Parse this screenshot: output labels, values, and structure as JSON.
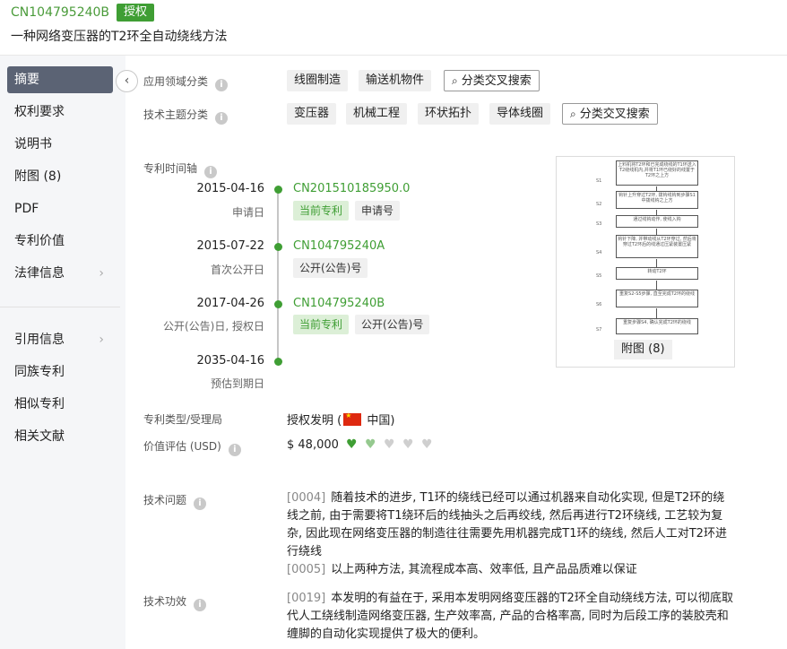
{
  "header": {
    "patent_number": "CN104795240B",
    "status": "授权",
    "title": "一种网络变压器的T2环全自动绕线方法"
  },
  "sidebar": {
    "items": [
      {
        "label": "摘要",
        "active": true
      },
      {
        "label": "权利要求"
      },
      {
        "label": "说明书"
      },
      {
        "label": "附图 (8)"
      },
      {
        "label": "PDF"
      },
      {
        "label": "专利价值"
      },
      {
        "label": "法律信息",
        "has_chevron": true
      }
    ],
    "items2": [
      {
        "label": "引用信息",
        "has_chevron": true
      },
      {
        "label": "同族专利"
      },
      {
        "label": "相似专利"
      },
      {
        "label": "相关文献"
      }
    ]
  },
  "classification": {
    "field_label": "应用领域分类",
    "field_tags": [
      "线圈制造",
      "输送机物件"
    ],
    "topic_label": "技术主题分类",
    "topic_tags": [
      "变压器",
      "机械工程",
      "环状拓扑",
      "导体线圈"
    ],
    "search_label": "分类交叉搜索"
  },
  "timeline": {
    "label": "专利时间轴",
    "events": [
      {
        "date": "2015-04-16",
        "sub": "申请日",
        "pub": "CN201510185950.0",
        "tags": [
          "当前专利",
          "申请号"
        ]
      },
      {
        "date": "2015-07-22",
        "sub": "首次公开日",
        "pub": "CN104795240A",
        "tags": [
          "公开(公告)号"
        ]
      },
      {
        "date": "2017-04-26",
        "sub": "公开(公告)日, 授权日",
        "pub": "CN104795240B",
        "tags": [
          "当前专利",
          "公开(公告)号"
        ]
      },
      {
        "date": "2035-04-16",
        "sub": "预估到期日"
      }
    ]
  },
  "figure": {
    "caption": "附图 (8)",
    "steps": [
      {
        "text": "上料机将T2环和已完成绕线的T1环送入T2绕线机内,并将T1环已绕好的线置于T2环之上方",
        "label": "S1"
      },
      {
        "text": "钩针上升穿过T2环, 拨钩线钩到步骤S1中拨线钩之上方",
        "label": "S2"
      },
      {
        "text": "通过线钩动作, 使线入钩",
        "label": "S3"
      },
      {
        "text": "钩针下降, 并带动线从T2环穿过, 然后将穿过T2环后的线通过压紧装置压紧",
        "label": "S4"
      },
      {
        "text": "转动T2环",
        "label": "S5"
      },
      {
        "text": "重复S2-S5步骤, 直至完成T2环的绕线",
        "label": "S6"
      },
      {
        "text": "重复步骤S4, 确认完成T2环的绕线",
        "label": "S7"
      }
    ]
  },
  "patent_type": {
    "label": "专利类型/受理局",
    "value": "授权发明",
    "country": "中国"
  },
  "valuation": {
    "label": "价值评估 (USD)",
    "value": "$ 48,000",
    "rating": 1.5,
    "max": 5
  },
  "tech_problem": {
    "label": "技术问题",
    "paragraphs": [
      {
        "num": "[0004]",
        "text": "随着技术的进步, T1环的绕线已经可以通过机器来自动化实现, 但是T2环的绕线之前, 由于需要将T1绕环后的线抽头之后再绞线, 然后再进行T2环绕线, 工艺较为复杂, 因此现在网络变压器的制造往往需要先用机器完成T1环的绕线, 然后人工对T2环进行绕线"
      },
      {
        "num": "[0005]",
        "text": "以上两种方法, 其流程成本高、效率低, 且产品品质难以保证"
      }
    ]
  },
  "tech_effect": {
    "label": "技术功效",
    "paragraphs": [
      {
        "num": "[0019]",
        "text": "本发明的有益在于, 采用本发明网络变压器的T2环全自动绕线方法, 可以彻底取代人工绕线制造网络变压器, 生产效率高, 产品的合格率高, 同时为后段工序的装胶壳和缠脚的自动化实现提供了极大的便利。"
      }
    ]
  },
  "colors": {
    "accent": "#3f9e34",
    "nav_active": "#5b6374"
  }
}
